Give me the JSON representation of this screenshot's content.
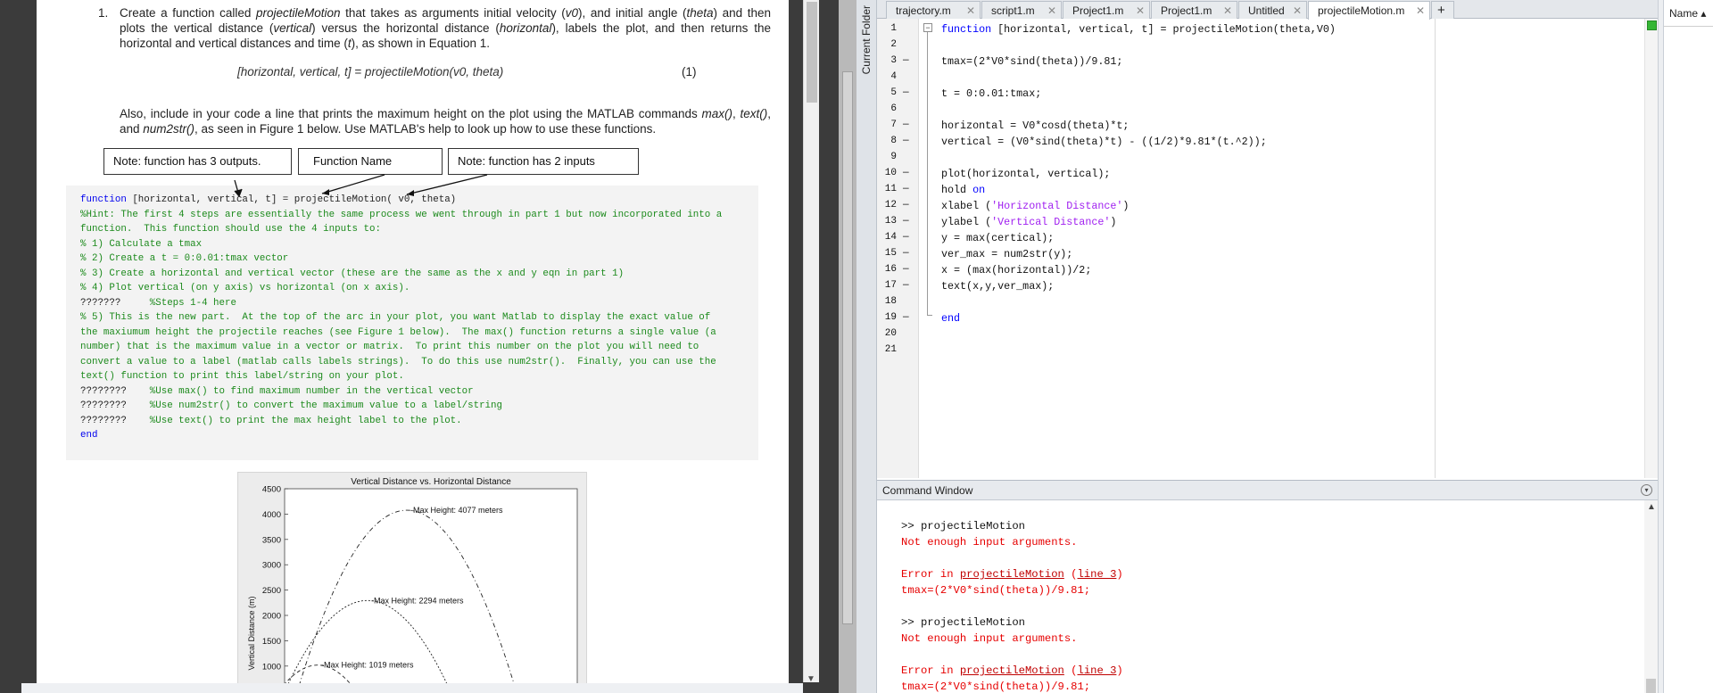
{
  "document": {
    "item_number": "1.",
    "paragraph1_html": "Create a function called <i>projectileMotion</i> that takes as arguments initial velocity (<i>v0</i>), and initial angle (<i>theta</i>) and then plots the vertical distance (<i>vertical</i>) versus the horizontal distance (<i>horizontal</i>), labels the plot, and then returns the horizontal and vertical distances and time (<i>t</i>), as shown in Equation 1.",
    "equation": "[horizontal, vertical, t] = projectileMotion(v0, theta)",
    "equation_number": "(1)",
    "paragraph2_html": "Also, include in your code a line that prints the maximum height on the plot using the MATLAB commands <i>max()</i>, <i>text()</i>, and <i>num2str()</i>, as seen in Figure 1 below. Use MATLAB's help to look up how to use these functions.",
    "notes": {
      "outputs": "Note: function has 3 outputs.",
      "name": "Function Name",
      "inputs": "Note: function has 2 inputs"
    },
    "code_lines": [
      {
        "kw": "function",
        "rest": " [horizontal, vertical, t] = projectileMotion( v0, theta)"
      },
      {
        "text": "%Hint: The first 4 steps are essentially the same process we went through in part 1 but now incorporated into a"
      },
      {
        "text": "function.  This function should use the 4 inputs to:"
      },
      {
        "text": "% 1) Calculate a tmax"
      },
      {
        "text": "% 2) Create a t = 0:0.01:tmax vector"
      },
      {
        "text": "% 3) Create a horizontal and vertical vector (these are the same as the x and y eqn in part 1)"
      },
      {
        "text": "% 4) Plot vertical (on y axis) vs horizontal (on x axis)."
      },
      {
        "q": "???????",
        "text": "     %Steps 1-4 here"
      },
      {
        "text": "% 5) This is the new part.  At the top of the arc in your plot, you want Matlab to display the exact value of"
      },
      {
        "text": "the maxiumum height the projectile reaches (see Figure 1 below).  The max() function returns a single value (a"
      },
      {
        "text": "number) that is the maximum value in a vector or matrix.  To print this number on the plot you will need to"
      },
      {
        "text": "convert a value to a label (matlab calls labels strings).  To do this use num2str().  Finally, you can use the"
      },
      {
        "text": "text() function to print this label/string on your plot."
      },
      {
        "q": "????????",
        "text": "    %Use max() to find maximum number in the vertical vector"
      },
      {
        "q": "????????",
        "text": "    %Use num2str() to convert the maximum value to a label/string"
      },
      {
        "q": "????????",
        "text": "    %Use text() to print the max height label to the plot."
      },
      {
        "kw": "end",
        "rest": ""
      }
    ],
    "figure": {
      "title": "Vertical Distance vs. Horizontal Distance",
      "ylabel": "Vertical Distance (m)",
      "yticks": [
        "4500",
        "4000",
        "3500",
        "3000",
        "2500",
        "2000",
        "1500",
        "1000"
      ],
      "annotations": [
        "Max Height: 4077 meters",
        "Max Height: 2294 meters",
        "Max Height: 1019 meters"
      ]
    }
  },
  "chart_data": {
    "type": "line",
    "title": "Vertical Distance vs. Horizontal Distance",
    "ylabel": "Vertical Distance (m)",
    "xlabel": "",
    "ylim": [
      1000,
      4500
    ],
    "yticks": [
      4500,
      4000,
      3500,
      3000,
      2500,
      2000,
      1500,
      1000
    ],
    "series": [
      {
        "peak": 4077
      },
      {
        "peak": 2294
      },
      {
        "peak": 1019
      }
    ],
    "annotations": [
      "Max Height: 4077 meters",
      "Max Height: 2294 meters",
      "Max Height: 1019 meters"
    ]
  },
  "matlab": {
    "side_label": "Current Folder",
    "tabs": [
      "trajectory.m",
      "script1.m",
      "Project1.m",
      "Project1.m",
      "Untitled",
      "projectileMotion.m"
    ],
    "active_tab": "projectileMotion.m",
    "add_tab": "+",
    "editor_lines": [
      {
        "n": "1",
        "m": "",
        "code": "<span class=\"kw\">function</span> [horizontal, vertical, t] = projectileMotion(theta,V0)"
      },
      {
        "n": "2",
        "m": "",
        "code": ""
      },
      {
        "n": "3",
        "m": "—",
        "code": "tmax=(2*V0*sind(theta))/9.81;"
      },
      {
        "n": "4",
        "m": "",
        "code": ""
      },
      {
        "n": "5",
        "m": "—",
        "code": "t = 0:0.01:tmax;"
      },
      {
        "n": "6",
        "m": "",
        "code": ""
      },
      {
        "n": "7",
        "m": "—",
        "code": "horizontal = V0*cosd(theta)*t;"
      },
      {
        "n": "8",
        "m": "—",
        "code": "vertical = (V0*sind(theta)*t) - ((1/2)*9.81*(t.^2));"
      },
      {
        "n": "9",
        "m": "",
        "code": ""
      },
      {
        "n": "10",
        "m": "—",
        "code": "plot(horizontal, vertical);"
      },
      {
        "n": "11",
        "m": "—",
        "code": "hold <span class=\"kw\">on</span>"
      },
      {
        "n": "12",
        "m": "—",
        "code": "xlabel (<span class=\"str\">'Horizontal Distance'</span>)"
      },
      {
        "n": "13",
        "m": "—",
        "code": "ylabel (<span class=\"str\">'Vertical Distance'</span>)"
      },
      {
        "n": "14",
        "m": "—",
        "code": "y = max(certical);"
      },
      {
        "n": "15",
        "m": "—",
        "code": "ver_max = num2str(y);"
      },
      {
        "n": "16",
        "m": "—",
        "code": "x = (max(horizontal))/2;"
      },
      {
        "n": "17",
        "m": "—",
        "code": "text(x,y,ver_max);"
      },
      {
        "n": "18",
        "m": "",
        "code": ""
      },
      {
        "n": "19",
        "m": "—",
        "code": "<span class=\"kw\">end</span>"
      },
      {
        "n": "20",
        "m": "",
        "code": ""
      },
      {
        "n": "21",
        "m": "",
        "code": ""
      }
    ],
    "command_window": {
      "title": "Command Window",
      "prompt1": ">> projectileMotion",
      "error1": "Not enough input arguments.",
      "error_in1": "Error in <u>projectileMotion</u> (<u>line 3</u>)",
      "err_code1": "tmax=(2*V0*sind(theta))/9.81;",
      "prompt2": ">> projectileMotion",
      "error2": "Not enough input arguments.",
      "error_in2": "Error in <u>projectileMotion</u> (<u>line 3</u>)",
      "err_code2": "tmax=(2*V0*sind(theta))/9.81;"
    },
    "workspace_header": "Name ▴"
  }
}
